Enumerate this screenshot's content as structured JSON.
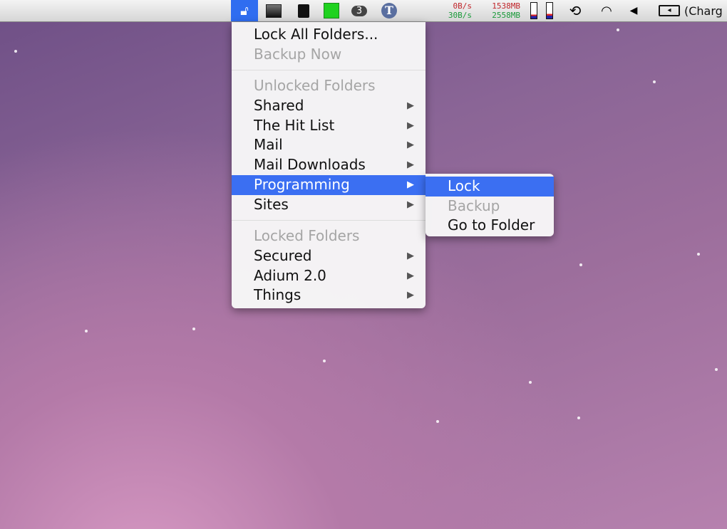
{
  "menubar": {
    "net_down": "0B/s",
    "net_up": "30B/s",
    "mem_used": "1538MB",
    "mem_free": "2558MB",
    "badge_count": "3",
    "t_icon": "T",
    "battery": "(Charg"
  },
  "menu": {
    "lock_all": "Lock All Folders...",
    "backup_now": "Backup Now",
    "unlocked_header": "Unlocked Folders",
    "unlocked": [
      "Shared",
      "The Hit List",
      "Mail",
      "Mail Downloads",
      "Programming",
      "Sites"
    ],
    "locked_header": "Locked Folders",
    "locked": [
      "Secured",
      "Adium 2.0",
      "Things"
    ]
  },
  "submenu": {
    "lock": "Lock",
    "backup": "Backup",
    "go_to_folder": "Go to Folder"
  },
  "colors": {
    "accent": "#3b6ff2"
  }
}
